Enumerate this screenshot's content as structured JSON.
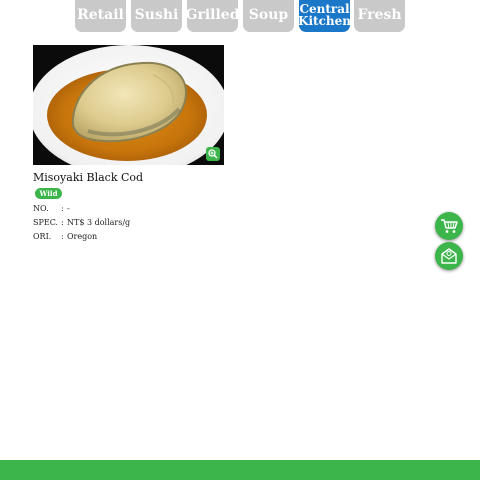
{
  "tabs": [
    {
      "line1": "Retail",
      "line2": ""
    },
    {
      "line1": "Sushi",
      "line2": ""
    },
    {
      "line1": "Grilled",
      "line2": ""
    },
    {
      "line1": "Soup",
      "line2": ""
    },
    {
      "line1": "Central",
      "line2": "Kitchen"
    },
    {
      "line1": "Fresh",
      "line2": ""
    }
  ],
  "active_tab": "Central Kitchen",
  "product": {
    "name": "Misoyaki Black Cod",
    "badge": "Wild",
    "specs": [
      {
        "label": "NO.",
        "sep": ":",
        "value": "-"
      },
      {
        "label": "SPEC.",
        "sep": ":",
        "value": "NT$ 3 dollars/g"
      },
      {
        "label": "ORI.",
        "sep": ":",
        "value": "Oregon"
      }
    ]
  },
  "icons": {
    "zoom": "zoom-in-icon",
    "cart": "shopping-cart-icon",
    "inquiry": "mail-inquiry-icon"
  },
  "colors": {
    "accent_green": "#3cb54a",
    "active_tab_blue": "#1b78c8",
    "inactive_tab_gray": "#c9c9c9"
  }
}
